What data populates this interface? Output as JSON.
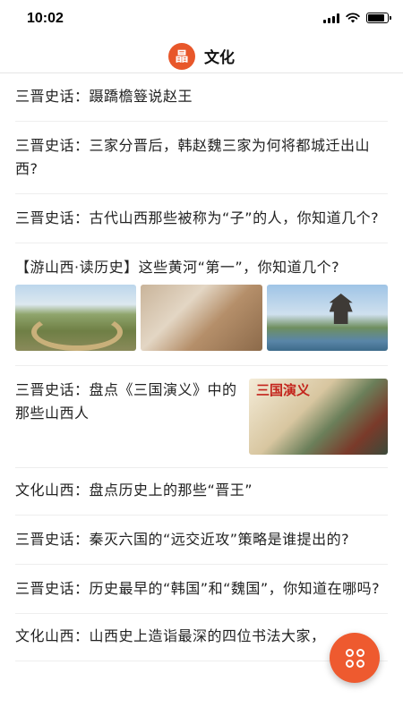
{
  "status_bar": {
    "time": "10:02",
    "battery_level": 0.85
  },
  "header": {
    "logo_text": "晶",
    "title": "文化"
  },
  "feed": [
    {
      "title": "三晋史话：蹑蹻檐簦说赵王"
    },
    {
      "title": "三晋史话：三家分晋后，韩赵魏三家为何将都城迁出山西?"
    },
    {
      "title": "三晋史话：古代山西那些被称为“子”的人，你知道几个?"
    },
    {
      "title": "【游山西·读历史】这些黄河“第一”，你知道几个?"
    },
    {
      "title": "三晋史话：盘点《三国演义》中的那些山西人",
      "image_caption": "三国演义"
    },
    {
      "title": "文化山西：盘点历史上的那些“晋王”"
    },
    {
      "title": "三晋史话：秦灭六国的“远交近攻”策略是谁提出的?"
    },
    {
      "title": "三晋史话：历史最早的“韩国”和“魏国”，你知道在哪吗?"
    },
    {
      "title": "文化山西：山西史上造诣最深的四位书法大家，"
    }
  ],
  "fab": {
    "icon": "four-circles-icon"
  },
  "colors": {
    "accent": "#ee5a2f",
    "logo": "#e8572a"
  }
}
